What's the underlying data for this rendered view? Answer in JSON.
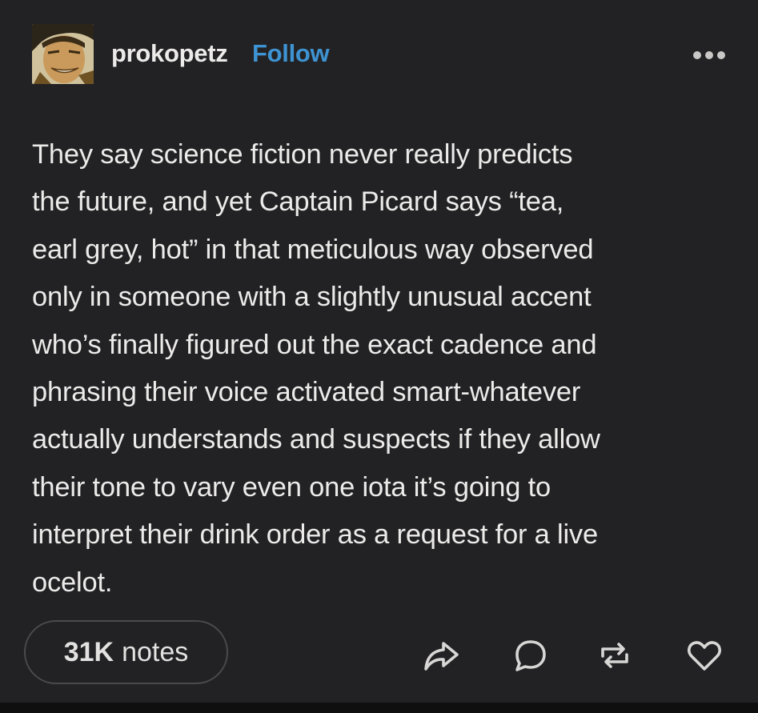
{
  "post": {
    "username": "prokopetz",
    "follow_label": "Follow",
    "body_lines": [
      "They say science fiction never really predicts",
      "the future, and yet Captain Picard says “tea,",
      "earl grey, hot” in that meticulous way observed",
      "only in someone with a slightly unusual accent",
      "who’s finally figured out the exact cadence and",
      "phrasing their voice activated smart-whatever",
      "actually understands and suspects if they allow",
      "their tone to vary even one iota it’s going to",
      "interpret their drink order as a request for a live",
      "ocelot."
    ]
  },
  "footer": {
    "notes_count": "31K",
    "notes_label": "notes",
    "actions": [
      "share-icon",
      "reply-icon",
      "reblog-icon",
      "like-icon"
    ]
  },
  "colors": {
    "background": "#222224",
    "text": "#ecebea",
    "accent": "#3e93d2"
  }
}
